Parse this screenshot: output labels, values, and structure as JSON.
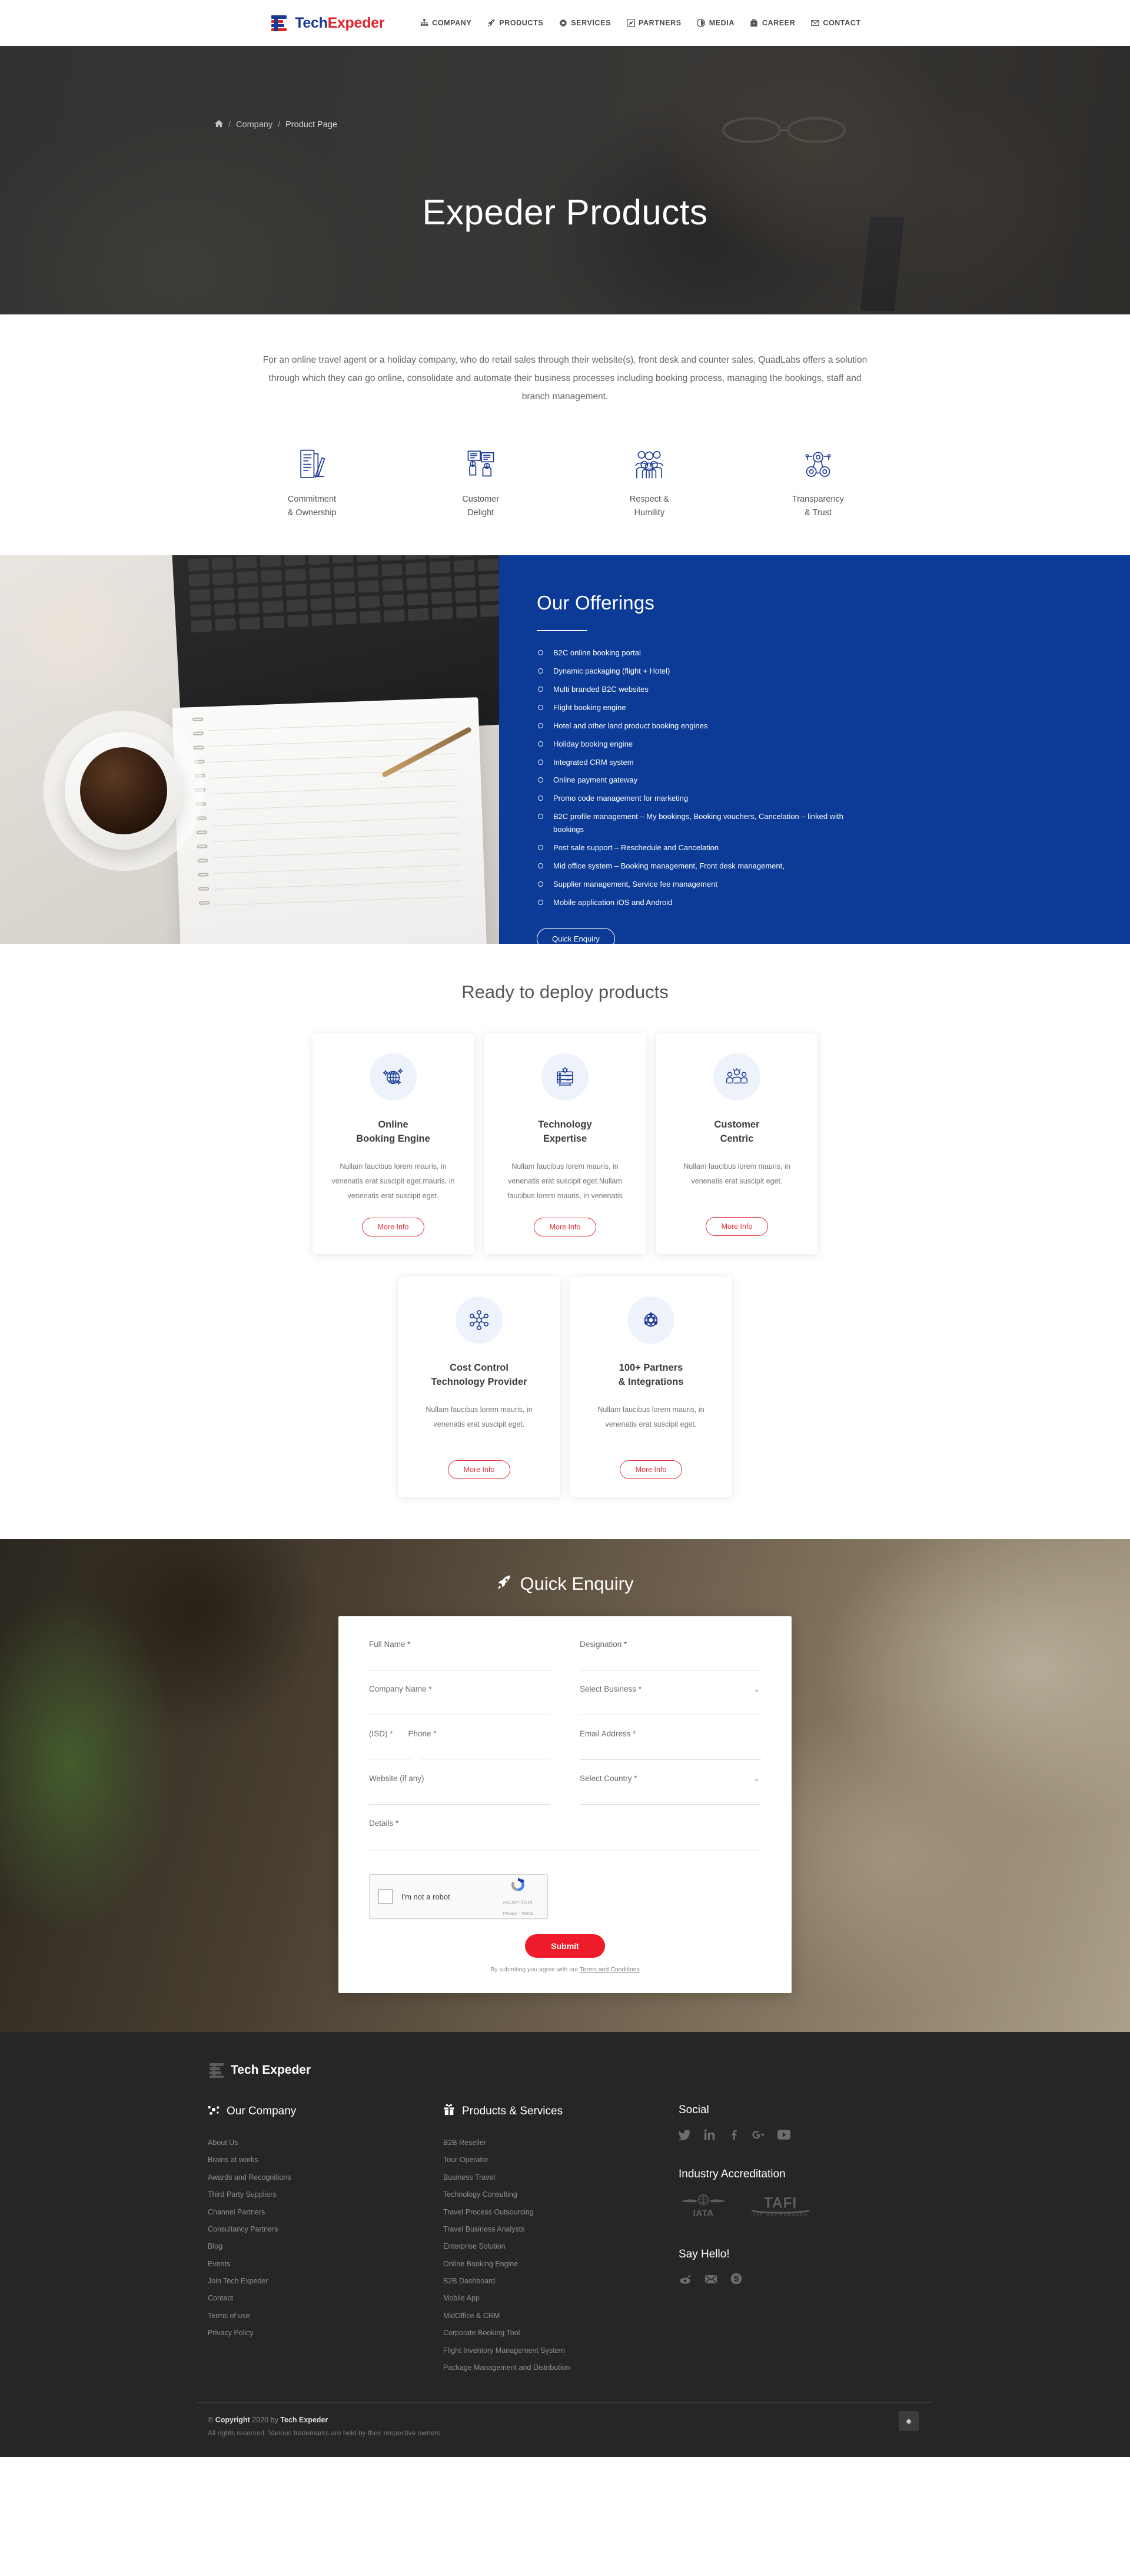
{
  "header": {
    "logo": {
      "part1": "Tech",
      "part2": "Expeder",
      "icon": "te-flag-logo"
    },
    "nav": [
      {
        "label": "COMPANY",
        "icon": "sitemap-icon"
      },
      {
        "label": "PRODUCTS",
        "icon": "rocket-icon"
      },
      {
        "label": "SERVICES",
        "icon": "gear-icon"
      },
      {
        "label": "PARTNERS",
        "icon": "handshake-icon"
      },
      {
        "label": "MEDIA",
        "icon": "camera-icon"
      },
      {
        "label": "CAREER",
        "icon": "briefcase-icon"
      },
      {
        "label": "CONTACT",
        "icon": "envelope-icon"
      }
    ]
  },
  "hero": {
    "breadcrumb": {
      "home_icon": "home-icon",
      "sep": "/",
      "item1": "Company",
      "item2": "Product Page"
    },
    "title": "Expeder Products"
  },
  "intro": {
    "paragraph": "For an online travel agent or a holiday company, who do retail sales through their website(s), front desk and counter sales, QuadLabs offers a solution through which they can go online, consolidate and automate their business processes including booking process, managing the bookings, staff and branch management."
  },
  "values": [
    {
      "icon": "document-pen-icon",
      "line1": "Commitment",
      "line2": "& Ownership"
    },
    {
      "icon": "speech-cards-icon",
      "line1": "Customer",
      "line2": "Delight"
    },
    {
      "icon": "people-group-icon",
      "line1": "Respect &",
      "line2": "Humility"
    },
    {
      "icon": "network-nodes-icon",
      "line1": "Transparency",
      "line2": "& Trust"
    }
  ],
  "offerings": {
    "title": "Our Offerings",
    "items": [
      "B2C online booking portal",
      "Dynamic packaging (flight + Hotel)",
      "Multi branded B2C websites",
      "Flight booking engine",
      "Hotel and other land product booking engines",
      "Holiday booking engine",
      "Integrated CRM system",
      "Online payment gateway",
      "Promo code management for marketing",
      "B2C profile management – My bookings, Booking vouchers, Cancelation – linked with bookings",
      "Post sale support – Reschedule and Cancelation",
      "Mid office system – Booking management, Front desk management,",
      "Supplier management, Service fee management",
      "Mobile application iOS and Android"
    ],
    "cta": "Quick Enquiry"
  },
  "products": {
    "title": "Ready to deploy products",
    "more_label": "More Info",
    "row1": [
      {
        "icon": "globe-sparkle-icon",
        "title": "Online\nBooking Engine",
        "body": "Nullam faucibus lorem mauris, in venenatis erat suscipit eget.mauris, in venenatis erat suscipit eget."
      },
      {
        "icon": "server-gear-icon",
        "title": "Technology\nExpertise",
        "body": "Nullam faucibus lorem mauris, in venenatis erat suscipit eget.Nullam faucibus lorem mauris, in venenatis"
      },
      {
        "icon": "customer-group-icon",
        "title": "Customer\nCentric",
        "body": "Nullam faucibus lorem mauris, in venenatis erat suscipit eget."
      }
    ],
    "row2": [
      {
        "icon": "network-share-icon",
        "title": "Cost Control\nTechnology Provider",
        "body": "Nullam faucibus lorem mauris, in venenatis erat suscipit eget."
      },
      {
        "icon": "atom-partners-icon",
        "title": "100+ Partners\n& Integrations",
        "body": "Nullam faucibus lorem mauris, in venenatis erat suscipit eget."
      }
    ]
  },
  "enquiry": {
    "title": "Quick Enquiry",
    "title_icon": "rocket-icon",
    "fields": {
      "full_name": {
        "label": "Full Name *",
        "value": ""
      },
      "designation": {
        "label": "Designation *",
        "value": ""
      },
      "company_name": {
        "label": "Company Name *",
        "value": ""
      },
      "select_business": {
        "label": "Select Business *",
        "value": "",
        "chevron": "chevron-down-icon"
      },
      "isd": {
        "label": "(ISD) *",
        "value": ""
      },
      "phone": {
        "label": "Phone *",
        "value": ""
      },
      "email": {
        "label": "Email Address *",
        "value": ""
      },
      "website": {
        "label": "Website (if any)",
        "value": ""
      },
      "select_country": {
        "label": "Select Country *",
        "value": "",
        "chevron": "chevron-down-icon"
      },
      "details": {
        "label": "Details *",
        "value": ""
      }
    },
    "recaptcha": {
      "label": "I'm not a robot",
      "brand": "reCAPTCHA",
      "legal": "Privacy - Terms"
    },
    "submit": "Submit",
    "terms_prefix": "By submiting you agree with our ",
    "terms_link": "Terms and Conditions"
  },
  "footer": {
    "logo": {
      "text": "Tech Expeder",
      "icon": "te-flag-logo"
    },
    "company": {
      "icon": "molecule-icon",
      "heading": "Our Company",
      "links": [
        "About Us",
        "Brains at works",
        "Awards and Recognitions",
        "Third Party Suppliers",
        "Channel Partners",
        "Consultancy Partners",
        "Blog",
        "Events",
        "Join Tech Expeder",
        "Contact",
        "Terms of use",
        "Privacy Policy"
      ]
    },
    "products": {
      "icon": "gift-box-icon",
      "heading": "Products & Services",
      "links": [
        "B2B Reseller",
        "Tour Operator",
        "Business Travel",
        "Technology Consulting",
        "Travel Process Outsourcing",
        "Travel Business Analysts",
        "Enterprise Solution",
        "Online Booking Engine",
        "B2B Dashboard",
        "Mobile App",
        "MidOffice & CRM",
        "Corporate Booking Tool",
        "Flight Inventory Management System",
        "Package Management and Distribution"
      ]
    },
    "social": {
      "heading": "Social",
      "icons": [
        "twitter-icon",
        "linkedin-icon",
        "facebook-icon",
        "google-plus-icon",
        "youtube-icon"
      ]
    },
    "accreditation": {
      "heading": "Industry Accreditation",
      "logos": [
        {
          "name": "iata-logo",
          "text": "IATA"
        },
        {
          "name": "tafi-logo",
          "text": "TAFI",
          "sub": "THE WAY FORWARD"
        }
      ]
    },
    "hello": {
      "heading": "Say Hello!",
      "icons": [
        "phone-icon",
        "email-icon",
        "skype-icon"
      ]
    },
    "copyright": {
      "symbol": "©",
      "word": "Copyright",
      "year": "2020",
      "by": "by",
      "brand": "Tech Expeder",
      "rights": "All rights reserved. Various trademarks are held by their respective owners."
    },
    "scroll_top_icon": "arrow-up-icon"
  },
  "colors": {
    "brand_navy": "#0b3b96",
    "brand_red": "#e0242c",
    "submit_red": "#ee1c2a",
    "footer_bg": "#262626"
  }
}
